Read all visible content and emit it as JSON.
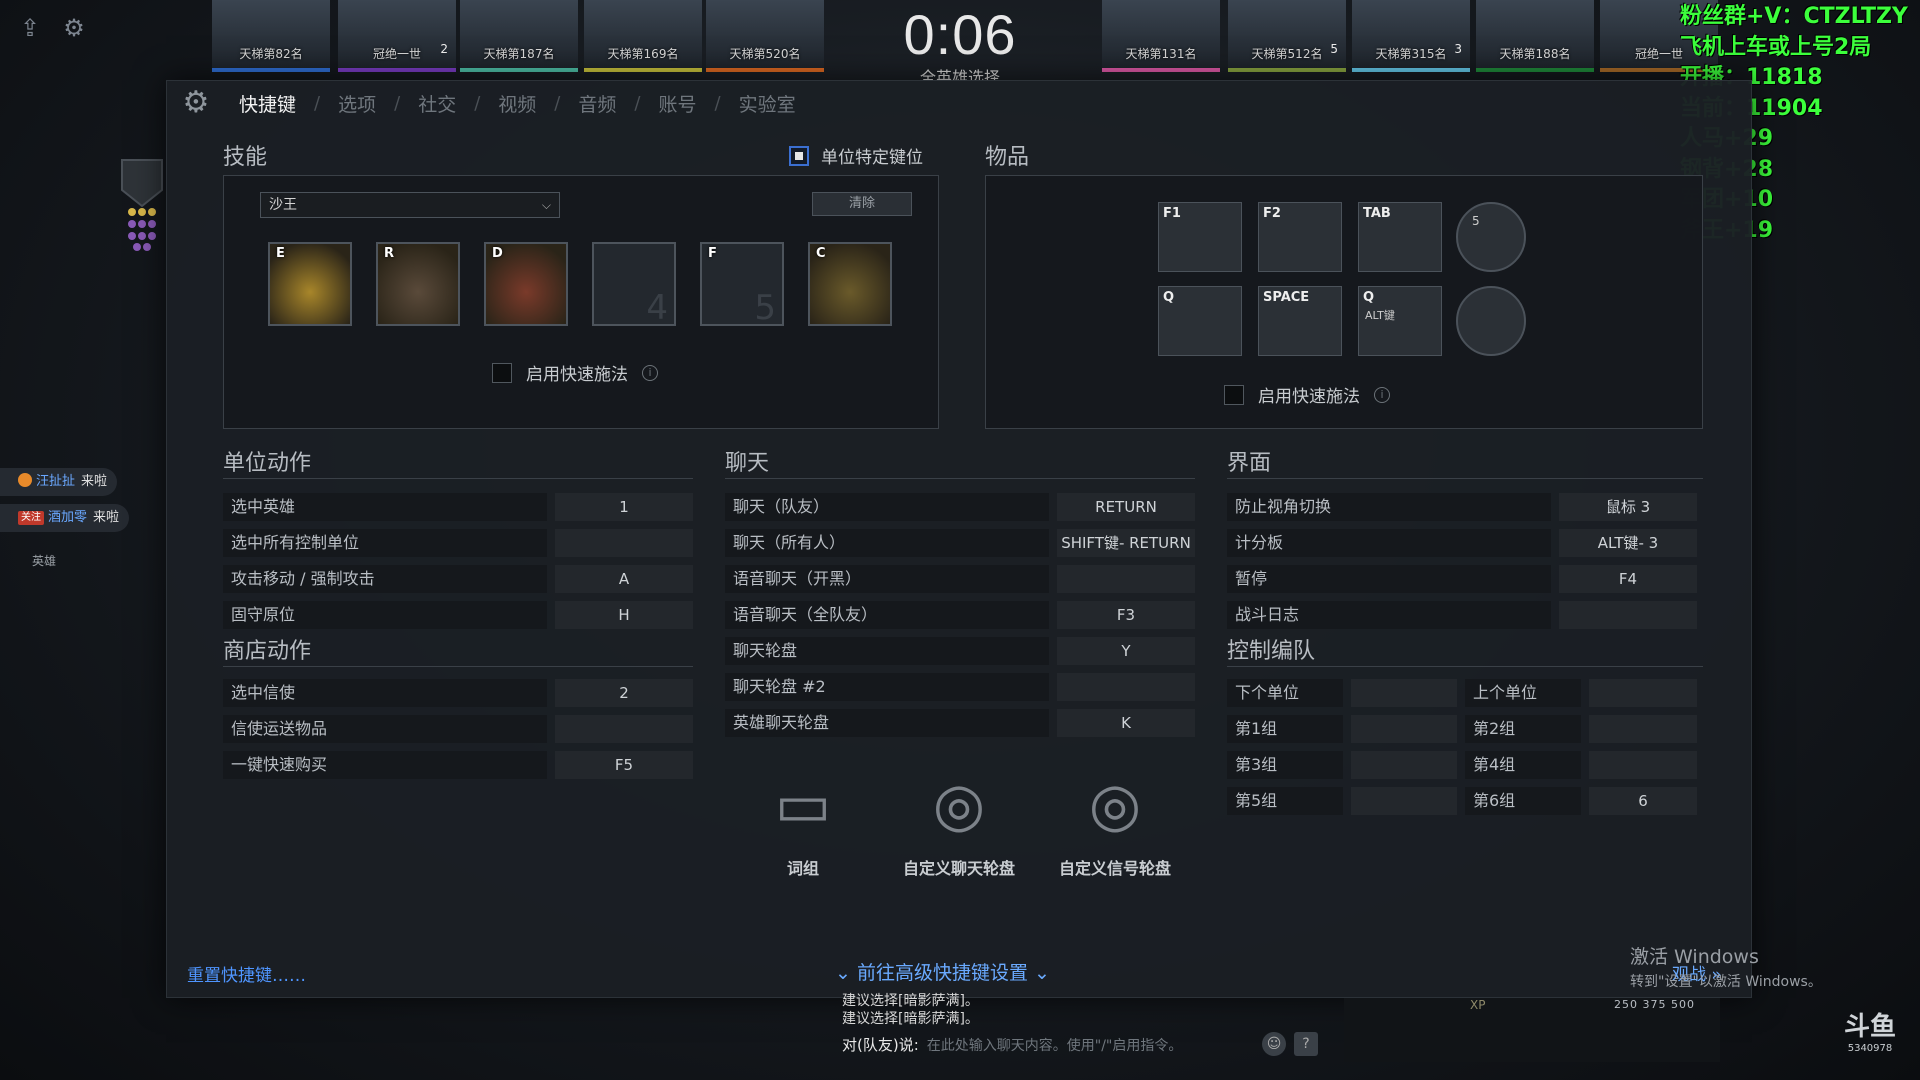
{
  "topbar": {
    "timer": "0:06",
    "timer_sub": "全英雄选择",
    "heroes_left": [
      {
        "rank": "天梯第82名",
        "num": "",
        "color": "#2f6fd6"
      },
      {
        "rank": "冠绝一世",
        "num": "2",
        "color": "#7a3cc4"
      },
      {
        "rank": "天梯第187名",
        "num": "",
        "color": "#4ec1a8"
      },
      {
        "rank": "天梯第169名",
        "num": "",
        "color": "#c9c33c"
      },
      {
        "rank": "天梯第520名",
        "num": "",
        "color": "#e06a22"
      }
    ],
    "heroes_right": [
      {
        "rank": "天梯第131名",
        "num": "",
        "color": "#e05aa8"
      },
      {
        "rank": "天梯第512名",
        "num": "5",
        "color": "#8aa640"
      },
      {
        "rank": "天梯第315名",
        "num": "3",
        "color": "#64c8e8"
      },
      {
        "rank": "天梯第188名",
        "num": "",
        "color": "#1f8a3a"
      },
      {
        "rank": "冠绝一世",
        "num": "",
        "color": "#a86a28"
      }
    ]
  },
  "stream_overlay": {
    "lines": [
      "粉丝群+V：CTZLTZY",
      "飞机上车或上号2局",
      "开播：11818",
      "当前：11904",
      "人马+29",
      "钢背+28",
      "军团+10",
      "斧王+19"
    ]
  },
  "left_chat": {
    "notices": [
      {
        "name": "汪扯扯",
        "msg": "来啦"
      },
      {
        "tag": "关注",
        "name": "酒加零",
        "msg": "来啦"
      }
    ],
    "side_label": "英雄"
  },
  "tabs": [
    "快捷键",
    "选项",
    "社交",
    "视频",
    "音频",
    "账号",
    "实验室"
  ],
  "abilities_section": {
    "title": "技能",
    "unit_specific_label": "单位特定键位",
    "hero_select": "沙王",
    "clear_label": "清除",
    "slots": [
      {
        "key": "E",
        "num": "",
        "filled": true
      },
      {
        "key": "R",
        "num": "",
        "filled": true
      },
      {
        "key": "D",
        "num": "",
        "filled": true
      },
      {
        "key": "",
        "num": "4",
        "filled": false
      },
      {
        "key": "F",
        "num": "5",
        "filled": false
      },
      {
        "key": "C",
        "num": "",
        "filled": true
      }
    ],
    "quickcast_label": "启用快速施法"
  },
  "items_section": {
    "title": "物品",
    "slots": [
      {
        "key": "F1",
        "sub": ""
      },
      {
        "key": "F2",
        "sub": ""
      },
      {
        "key": "TAB",
        "sub": ""
      },
      {
        "key": "Q",
        "sub": ""
      },
      {
        "key": "SPACE",
        "sub": ""
      },
      {
        "key": "Q",
        "sub": "ALT键"
      }
    ],
    "round_slots": [
      "5",
      ""
    ],
    "quickcast_label": "启用快速施法"
  },
  "unit_actions": {
    "title": "单位动作",
    "rows": [
      {
        "label": "选中英雄",
        "bind": "1"
      },
      {
        "label": "选中所有控制单位",
        "bind": ""
      },
      {
        "label": "攻击移动 / 强制攻击",
        "bind": "A"
      },
      {
        "label": "固守原位",
        "bind": "H"
      }
    ]
  },
  "shop_actions": {
    "title": "商店动作",
    "rows": [
      {
        "label": "选中信使",
        "bind": "2"
      },
      {
        "label": "信使运送物品",
        "bind": ""
      },
      {
        "label": "一键快速购买",
        "bind": "F5"
      }
    ]
  },
  "chat_section": {
    "title": "聊天",
    "rows": [
      {
        "label": "聊天（队友）",
        "bind": "RETURN"
      },
      {
        "label": "聊天（所有人）",
        "bind": "SHIFT键- RETURN"
      },
      {
        "label": "语音聊天（开黑）",
        "bind": ""
      },
      {
        "label": "语音聊天（全队友）",
        "bind": "F3"
      },
      {
        "label": "聊天轮盘",
        "bind": "Y"
      },
      {
        "label": "聊天轮盘 #2",
        "bind": ""
      },
      {
        "label": "英雄聊天轮盘",
        "bind": "K"
      }
    ],
    "wheels": [
      "词组",
      "自定义聊天轮盘",
      "自定义信号轮盘"
    ]
  },
  "interface_section": {
    "title": "界面",
    "rows": [
      {
        "label": "防止视角切换",
        "bind": "鼠标 3"
      },
      {
        "label": "计分板",
        "bind": "ALT键- 3"
      },
      {
        "label": "暂停",
        "bind": "F4"
      },
      {
        "label": "战斗日志",
        "bind": ""
      }
    ]
  },
  "control_groups": {
    "title": "控制编队",
    "rows": [
      {
        "l1": "下个单位",
        "b1": "",
        "l2": "上个单位",
        "b2": ""
      },
      {
        "l1": "第1组",
        "b1": "",
        "l2": "第2组",
        "b2": ""
      },
      {
        "l1": "第3组",
        "b1": "",
        "l2": "第4组",
        "b2": ""
      },
      {
        "l1": "第5组",
        "b1": "",
        "l2": "第6组",
        "b2": "6"
      }
    ]
  },
  "footer": {
    "reset": "重置快捷键……",
    "advanced": "前往高级快捷键设置",
    "spectate": "观战",
    "watermark_title": "激活 Windows",
    "watermark_sub": "转到\"设置\"以激活 Windows。"
  },
  "bottom_chat": {
    "lines": [
      "建议选择[暗影萨满]。",
      "建议选择[暗影萨满]。"
    ],
    "prefix": "对(队友)说:",
    "placeholder": "在此处输入聊天内容。使用\"/\"启用指令。",
    "xp_label": "XP",
    "xp_values": "250 375 500"
  },
  "douyu": {
    "logo": "斗鱼",
    "room": "5340978"
  }
}
